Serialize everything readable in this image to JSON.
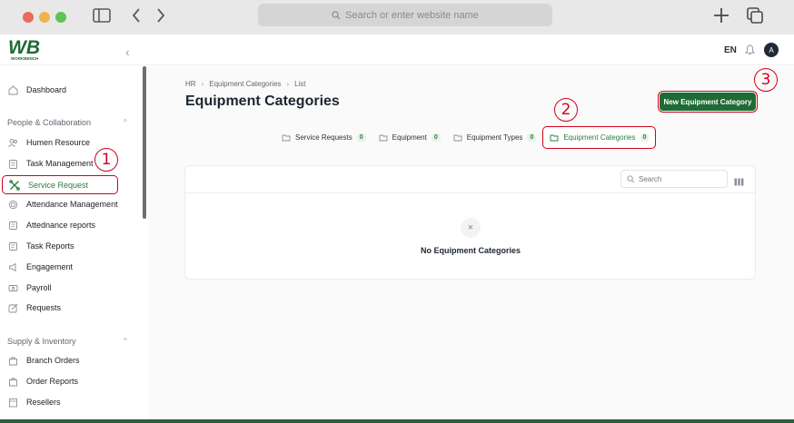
{
  "browser": {
    "address_placeholder": "Search or enter website name"
  },
  "header": {
    "logo_text": "WB",
    "logo_sub": "WORKBENCH",
    "lang": "EN",
    "avatar": "A"
  },
  "sidebar": {
    "dashboard": "Dashboard",
    "section_people": "People & Collaboration",
    "items_people": [
      "Humen Resource",
      "Task Management",
      "Service Request",
      "Attendance Management",
      "Attednance reports",
      "Task Reports",
      "Engagement",
      "Payroll",
      "Requests"
    ],
    "section_supply": "Supply & Inventory",
    "items_supply": [
      "Branch Orders",
      "Order Reports",
      "Resellers"
    ]
  },
  "main": {
    "breadcrumb": [
      "HR",
      "Equipment Categories",
      "List"
    ],
    "title": "Equipment Categories",
    "new_button": "New Equipment Category",
    "tabs": [
      {
        "label": "Service Requests",
        "count": "0"
      },
      {
        "label": "Equipment",
        "count": "0"
      },
      {
        "label": "Equipment Types",
        "count": "0"
      },
      {
        "label": "Equipment Categories",
        "count": "0"
      }
    ],
    "search_placeholder": "Search",
    "empty_text": "No Equipment Categories"
  },
  "annotations": [
    "1",
    "2",
    "3"
  ],
  "colors": {
    "accent": "#1f6b33",
    "highlight": "#d0021b"
  }
}
